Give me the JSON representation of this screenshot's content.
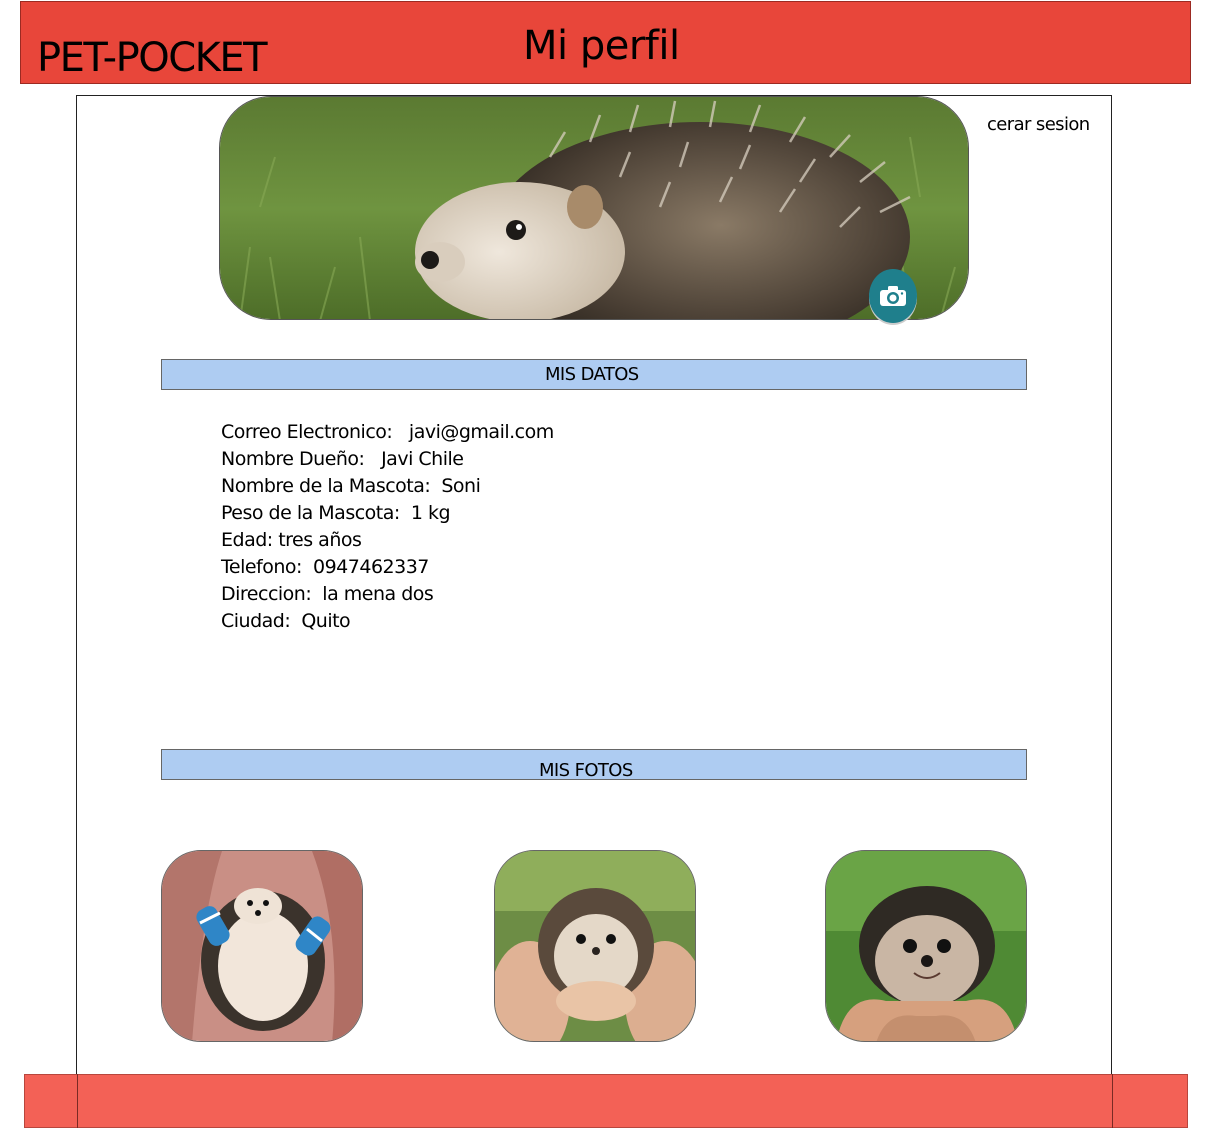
{
  "header": {
    "brand": "PET-POCKET",
    "title": "Mi perfil",
    "color": "#e8463a"
  },
  "profile": {
    "cover_image": "hedgehog-on-grass",
    "camera_icon": "camera-icon",
    "logout_label": "cerar sesion"
  },
  "sections": {
    "data_title": "MIS DATOS",
    "photos_title": "MIS FOTOS",
    "bar_color": "#aeccf2"
  },
  "details": [
    {
      "text": "Correo Electronico:   javi@gmail.com"
    },
    {
      "text": "Nombre Dueño:   Javi Chile"
    },
    {
      "text": "Nombre de la Mascota:  Soni"
    },
    {
      "text": "Peso de la Mascota:  1 kg"
    },
    {
      "text": "Edad: tres años"
    },
    {
      "text": "Telefono:  0947462337"
    },
    {
      "text": "Direccion:  la mena dos"
    },
    {
      "text": "Ciudad:  Quito"
    }
  ],
  "photos": [
    {
      "image": "hedgehog-in-socks"
    },
    {
      "image": "hedgehog-in-hand"
    },
    {
      "image": "hedgehog-smiling"
    }
  ],
  "footer": {
    "color": "#f36156"
  }
}
